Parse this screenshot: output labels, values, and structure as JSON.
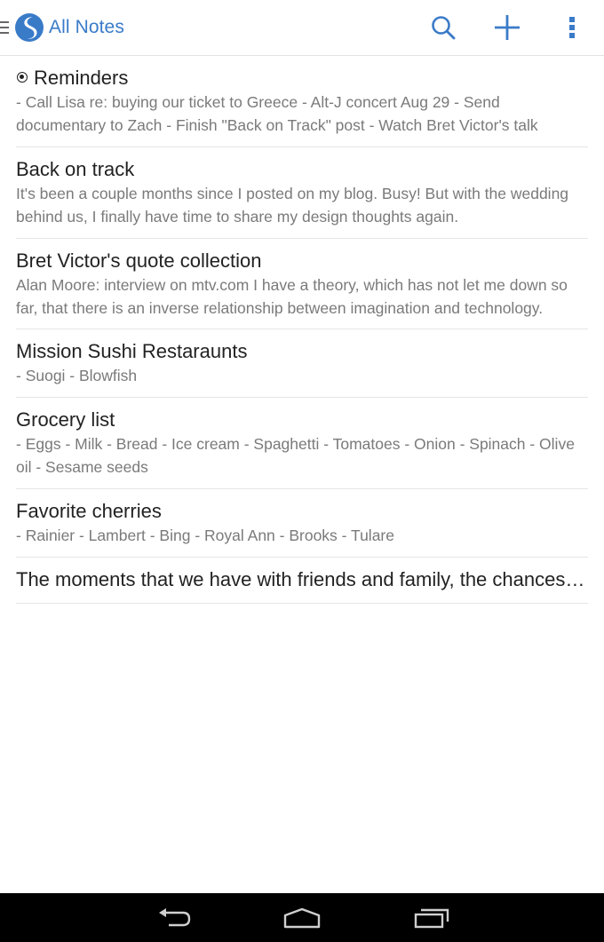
{
  "header": {
    "title": "All Notes",
    "accent_color": "#3a7bc8",
    "icons": [
      "menu-icon",
      "simplenote-logo",
      "search-icon",
      "add-icon",
      "overflow-menu-icon"
    ]
  },
  "notes": [
    {
      "title": "Reminders",
      "pinned": true,
      "preview": "- Call Lisa re: buying our ticket to Greece - Alt-J concert Aug 29 - Send documentary to Zach - Finish \"Back on Track\" post - Watch Bret Victor's talk"
    },
    {
      "title": "Back on track",
      "pinned": false,
      "preview": "It's been a couple months since I posted on my blog. Busy! But with the wedding behind us, I finally have time to share my design thoughts again."
    },
    {
      "title": "Bret Victor's quote collection",
      "pinned": false,
      "preview": "Alan Moore: interview on mtv.com I have a theory, which has not let me down so far, that there is an inverse relationship between imagination and technology."
    },
    {
      "title": "Mission Sushi Restaraunts",
      "pinned": false,
      "preview": "- Suogi - Blowfish"
    },
    {
      "title": "Grocery list",
      "pinned": false,
      "preview": "- Eggs - Milk - Bread - Ice cream - Spaghetti - Tomatoes - Onion - Spinach - Olive oil - Sesame seeds"
    },
    {
      "title": "Favorite cherries",
      "pinned": false,
      "preview": "- Rainier - Lambert - Bing - Royal Ann - Brooks - Tulare"
    },
    {
      "title": "The moments that we have with friends and family, the chances we take",
      "pinned": false,
      "preview": ""
    }
  ],
  "nav_bar": {
    "icons": [
      "back-icon",
      "home-icon",
      "recents-icon"
    ]
  }
}
